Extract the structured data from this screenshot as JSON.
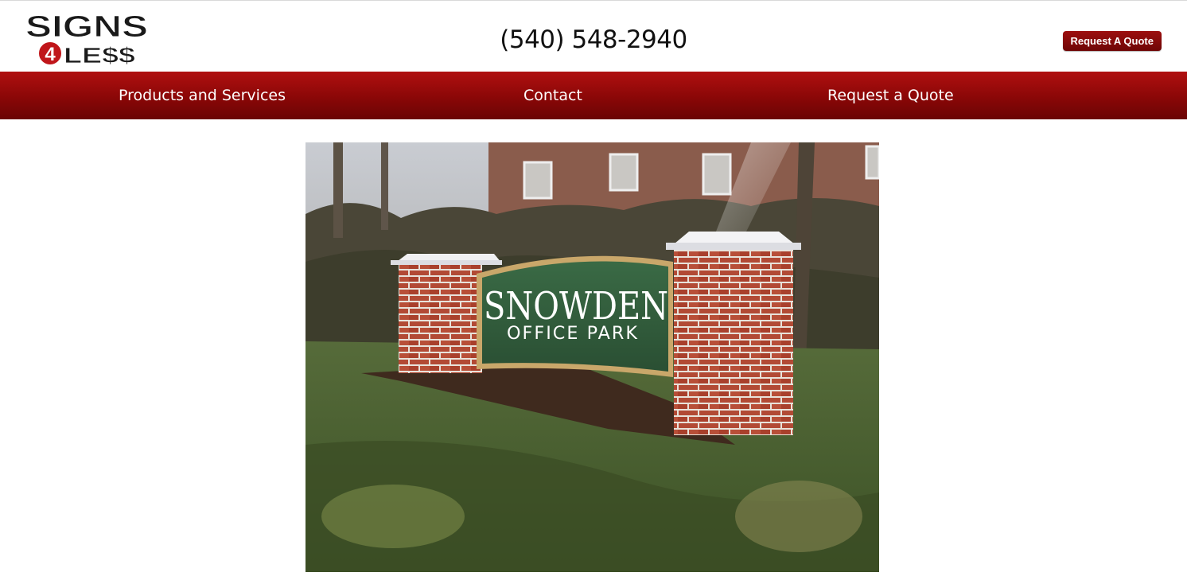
{
  "header": {
    "logo": {
      "line1": "SIGNS",
      "badge": "4",
      "line2": "LE$$"
    },
    "phone": "(540) 548-2940",
    "quote_button": "Request A Quote"
  },
  "nav": {
    "items": [
      {
        "label": "Products and Services"
      },
      {
        "label": "Contact"
      },
      {
        "label": "Request a Quote"
      }
    ]
  },
  "hero": {
    "sign_line1": "SNOWDEN",
    "sign_line2": "OFFICE PARK"
  },
  "colors": {
    "nav_red": "#9d0c0c",
    "button_red": "#8a0a0a",
    "sign_green": "#2f5a3a",
    "brick": "#a8402c"
  }
}
